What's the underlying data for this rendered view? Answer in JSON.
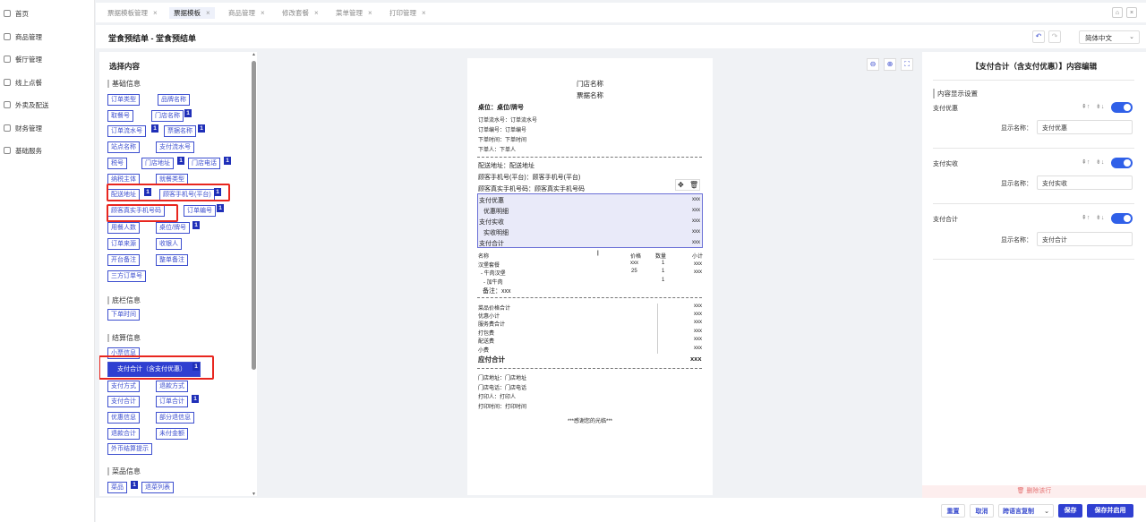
{
  "nav": [
    {
      "label": "首页",
      "icon": "home-icon"
    },
    {
      "label": "商品管理",
      "icon": "goods-icon"
    },
    {
      "label": "餐厅管理",
      "icon": "restaurant-icon"
    },
    {
      "label": "线上点餐",
      "icon": "order-icon"
    },
    {
      "label": "外卖及配送",
      "icon": "delivery-icon"
    },
    {
      "label": "财务管理",
      "icon": "finance-icon"
    },
    {
      "label": "基础服务",
      "icon": "service-icon"
    }
  ],
  "tabs": [
    "票据模板管理",
    "票据模板",
    "商品管理",
    "修改套餐",
    "菜单管理",
    "打印管理"
  ],
  "active_tab": 1,
  "page_title": "堂食预结单 - 堂食预结单",
  "language": "简体中文",
  "left_panel": {
    "title": "选择内容",
    "sections": [
      "基础信息",
      "底栏信息",
      "结算信息",
      "菜品信息"
    ],
    "chips": {
      "c1": "订单类型",
      "c2": "品牌名称",
      "c3": "取餐号",
      "c4": "门店名称",
      "c5": "订单流水号",
      "c6": "票据名称",
      "c7": "站点名称",
      "c8": "支付流水号",
      "c9": "税号",
      "c10": "门店地址",
      "c11": "门店电话",
      "c12": "纳税主体",
      "c13": "就餐类型",
      "c14": "配送地址",
      "c15": "顾客手机号(平台)",
      "c16": "顾客真实手机号码",
      "c17": "订单编号",
      "c18": "用餐人数",
      "c19": "桌位/牌号",
      "c20": "订单来源",
      "c21": "收银人",
      "c22": "开台备注",
      "c23": "整单备注",
      "c24": "三方订单号",
      "c25": "下单时间",
      "c26": "小票信息",
      "c27": "支付合计（含支付优惠）",
      "c28": "支付方式",
      "c29": "退款方式",
      "c30": "支付合计",
      "c31": "订单合计",
      "c32": "优惠信息",
      "c33": "部分退信息",
      "c34": "退款合计",
      "c35": "未付金额",
      "c36": "外币结算提示",
      "c37": "菜品",
      "c38": "退菜列表"
    },
    "badge": "1"
  },
  "receipt": {
    "store_name": "门店名称",
    "ticket_name": "票据名称",
    "table": "桌位：桌位/牌号",
    "serial": "订单流水号：订单流水号",
    "order_no": "订单编号：订单编号",
    "order_time": "下单时间：下单时间",
    "cashier": "下单人：下单人",
    "address": "配送地址：配送地址",
    "phone_platform": "顾客手机号(平台)：顾客手机号(平台)",
    "phone_real": "顾客真实手机号码：顾客真实手机号码",
    "pay_lines": [
      {
        "label": "支付优惠",
        "value": "xxx"
      },
      {
        "label": "优惠明细",
        "value": "xxx"
      },
      {
        "label": "支付实收",
        "value": "xxx"
      },
      {
        "label": "实收明细",
        "value": "xxx"
      },
      {
        "label": "支付合计",
        "value": "xxx"
      }
    ],
    "item_headers": [
      "名称",
      "价格",
      "数量",
      "小计"
    ],
    "items": [
      {
        "name": "汉堡套餐",
        "price": "xxx",
        "qty": "1",
        "sub": "xxx"
      },
      {
        "name": "- 牛肉汉堡",
        "price": "25",
        "qty": "1",
        "sub": "xxx"
      },
      {
        "name": "- 加牛肉",
        "price": "",
        "qty": "1",
        "sub": ""
      }
    ],
    "remark": "备注：xxx",
    "totals": [
      {
        "label": "菜品价格合计",
        "value": "xxx"
      },
      {
        "label": "优惠小计",
        "value": "xxx"
      },
      {
        "label": "服务费合计",
        "value": "xxx"
      },
      {
        "label": "打包费",
        "value": "xxx"
      },
      {
        "label": "配送费",
        "value": "xxx"
      },
      {
        "label": "小费",
        "value": "xxx"
      }
    ],
    "due_label": "应付合计",
    "due_value": "xxx",
    "footer_lines": [
      "门店地址：门店地址",
      "门店电话：门店电话",
      "打印人：打印人",
      "打印时间：打印时间"
    ],
    "thanks": "***感谢您的光临***"
  },
  "right_panel": {
    "title": "【支付合计（含支付优惠）】内容编辑",
    "subtitle": "内容显示设置",
    "display_name_label": "显示名称：",
    "fields": [
      {
        "label": "支付优惠",
        "display": "支付优惠",
        "enabled": true
      },
      {
        "label": "支付实收",
        "display": "支付实收",
        "enabled": true
      },
      {
        "label": "支付合计",
        "display": "支付合计",
        "enabled": true
      }
    ],
    "delete_row": "删除该行"
  },
  "footer": {
    "reset": "重置",
    "cancel": "取消",
    "multi_lang": "跨语言复制",
    "save": "保存",
    "save_enable": "保存并启用"
  },
  "colors": {
    "accent": "#2f3fd1",
    "highlight": "#e8261f"
  }
}
